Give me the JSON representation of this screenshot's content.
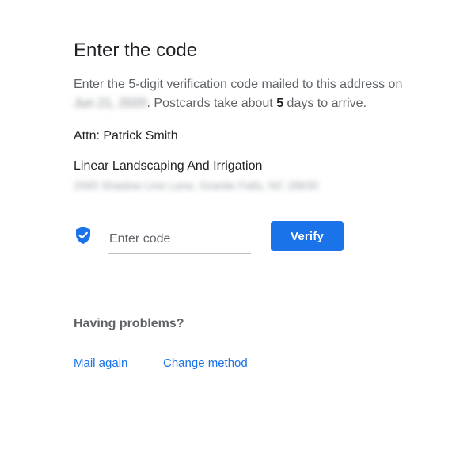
{
  "header": {
    "title": "Enter the code"
  },
  "description": {
    "prefix": "Enter the 5-digit verification code mailed to this address on",
    "date_blurred": "Jun 21, 2020",
    "mid": ". Postcards take about ",
    "days": "5",
    "suffix": " days to arrive."
  },
  "recipient": {
    "attn": "Attn: Patrick Smith",
    "business_name": "Linear Landscaping And Irrigation",
    "address_blurred": "2565 Shadow Line Lane, Granite Falls, NC 28630"
  },
  "verification": {
    "icon": "verified-shield-icon",
    "code_value": "",
    "code_placeholder": "Enter code",
    "verify_label": "Verify"
  },
  "help": {
    "heading": "Having problems?",
    "mail_again_label": "Mail again",
    "change_method_label": "Change method"
  },
  "colors": {
    "accent": "#1a73e8",
    "primary_text": "#202124",
    "secondary_text": "#5f6368"
  }
}
